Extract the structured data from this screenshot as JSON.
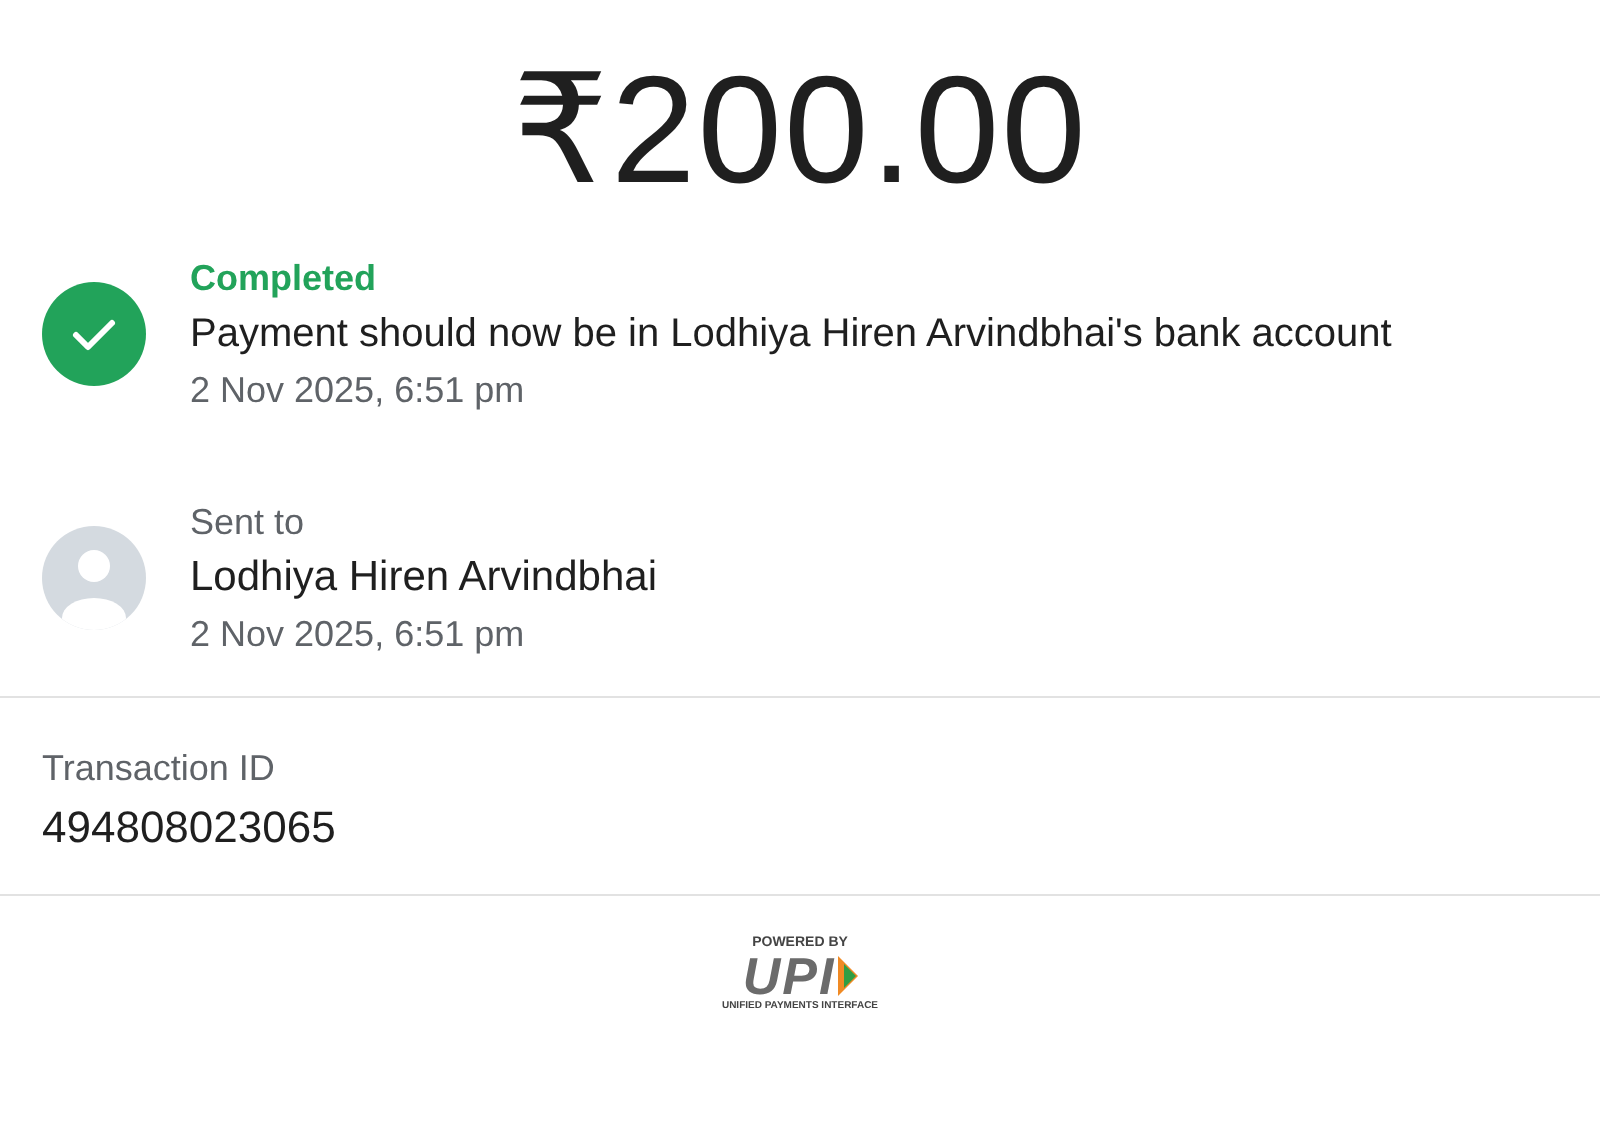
{
  "amount": "₹200.00",
  "status": {
    "succeeded": true,
    "label": "Completed",
    "message": "Payment should now be in Lodhiya Hiren Arvindbhai's bank account",
    "time": "2 Nov 2025, 6:51 pm"
  },
  "recipient": {
    "label": "Sent to",
    "name": "Lodhiya Hiren Arvindbhai",
    "time": "2 Nov 2025, 6:51 pm"
  },
  "transaction": {
    "label": "Transaction ID",
    "value": "494808023065"
  },
  "footer": {
    "powered_by": "POWERED BY",
    "brand": "UPI",
    "tagline": "UNIFIED PAYMENTS INTERFACE"
  }
}
